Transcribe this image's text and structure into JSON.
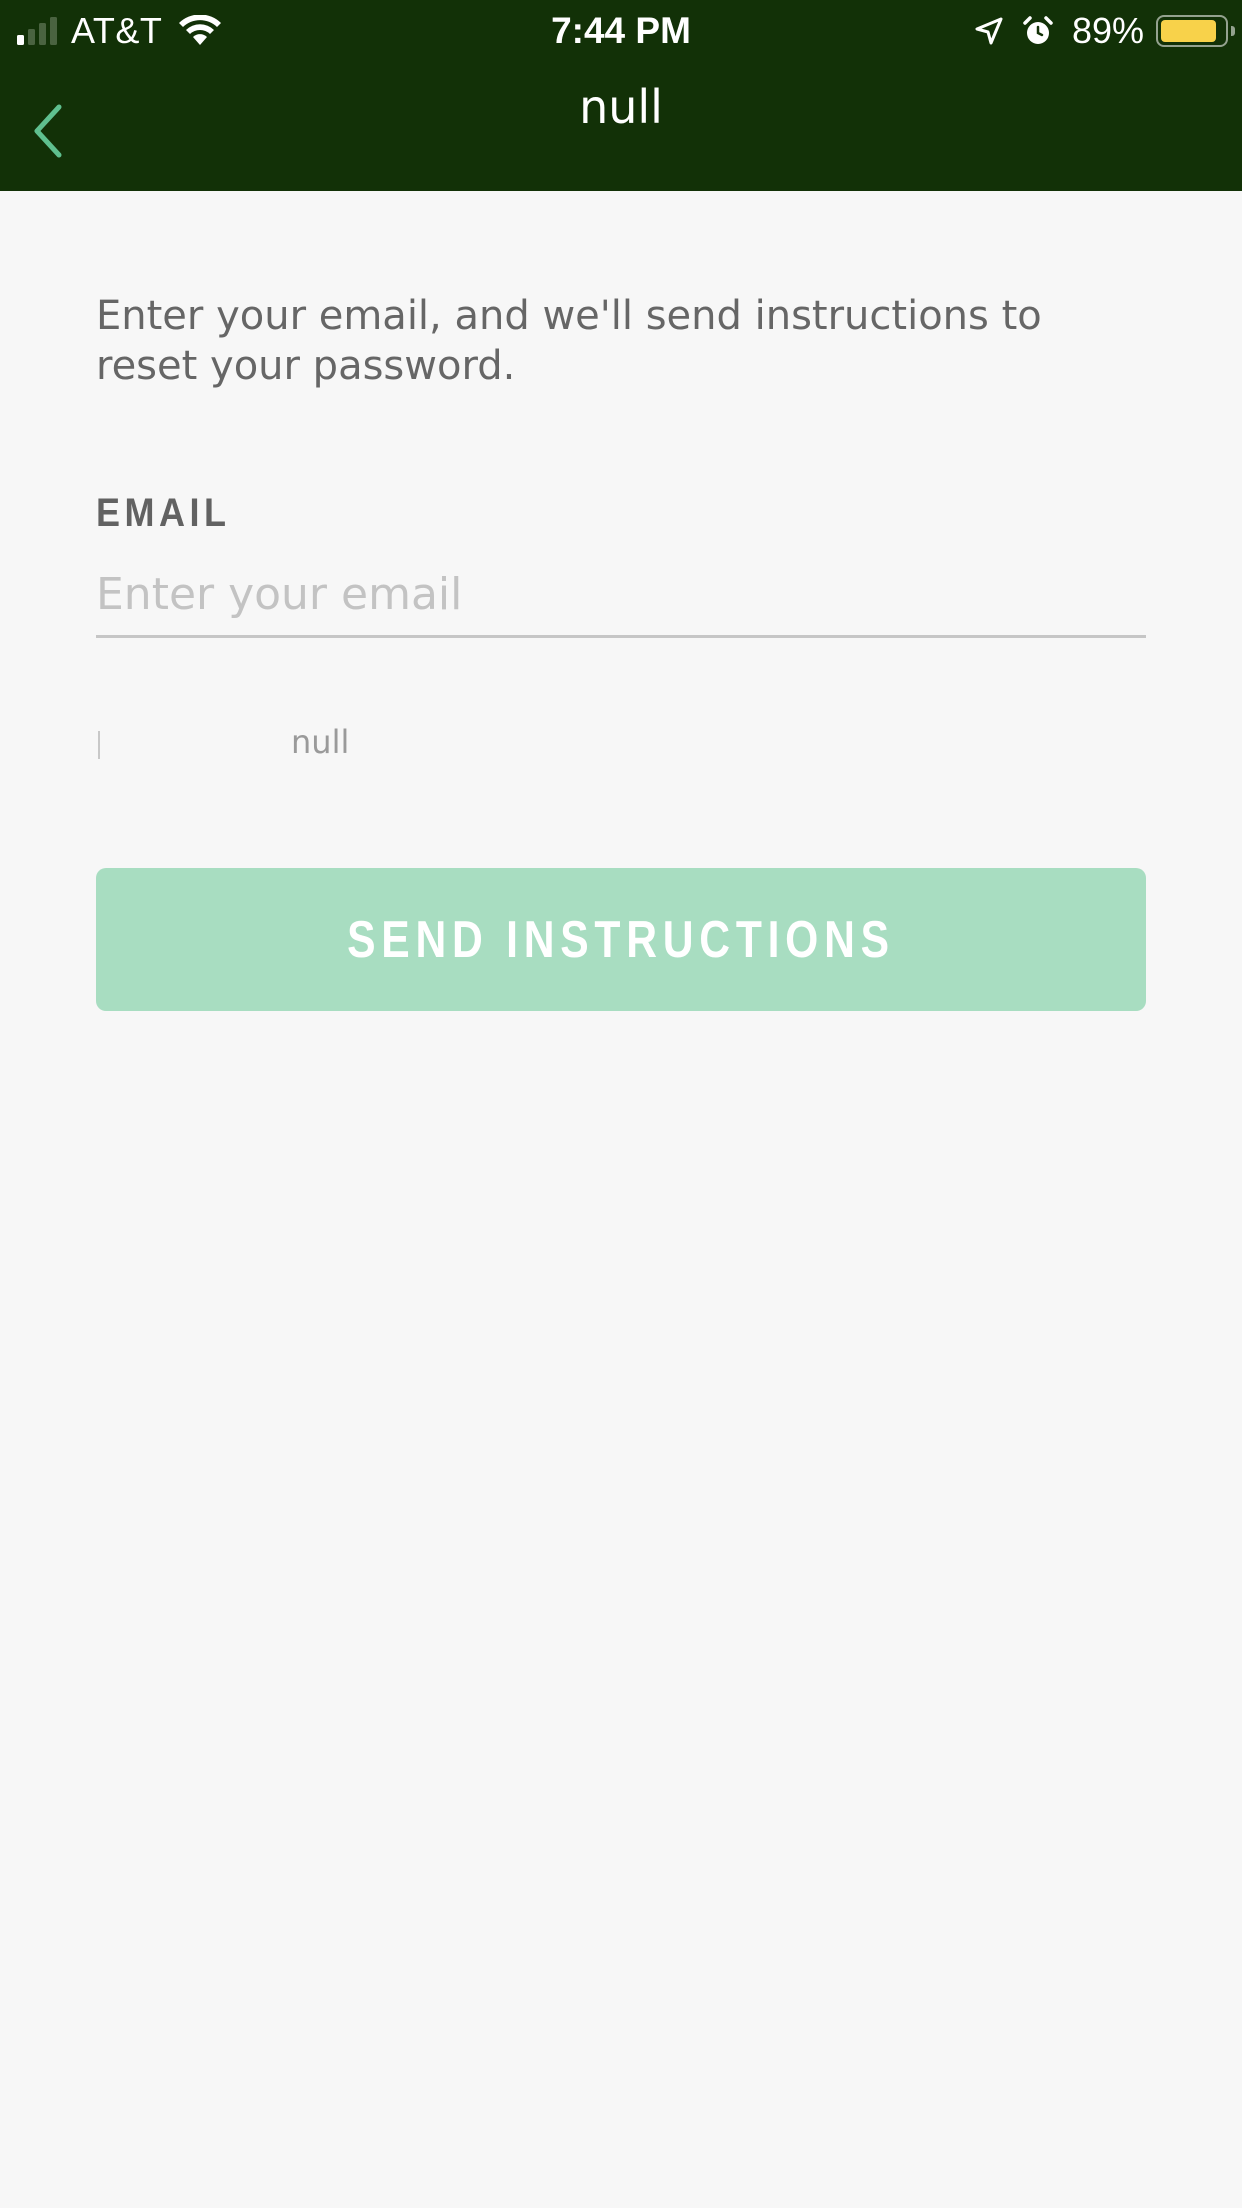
{
  "status_bar": {
    "carrier": "AT&T",
    "time": "7:44 PM",
    "battery_percent": "89%",
    "battery_level": 0.89,
    "signal_bars_filled": 1,
    "signal_bars_total": 4
  },
  "nav": {
    "title": "null",
    "back_icon": "chevron-left-icon",
    "accent_color": "#5fc08f",
    "background_color": "#123107"
  },
  "form": {
    "instructions": "Enter your email, and we'll send instructions to reset your password.",
    "email_label": "EMAIL",
    "email_placeholder": "Enter your email",
    "email_value": "",
    "caption": "null",
    "submit_label": "SEND INSTRUCTIONS",
    "submit_color": "#a8ddc1"
  }
}
